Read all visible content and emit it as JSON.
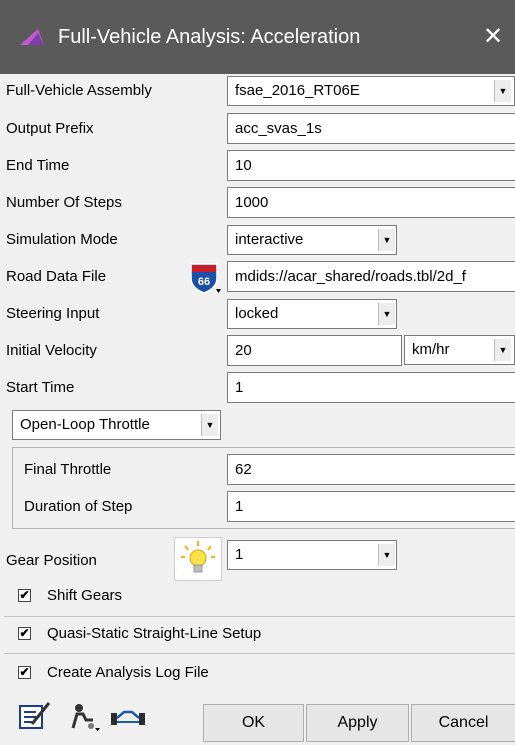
{
  "window": {
    "title": "Full-Vehicle Analysis: Acceleration",
    "close_glyph": "✕"
  },
  "form": {
    "assembly": {
      "label": "Full-Vehicle Assembly",
      "value": "fsae_2016_RT06E"
    },
    "output_prefix": {
      "label": "Output Prefix",
      "value": "acc_svas_1s"
    },
    "end_time": {
      "label": "End Time",
      "value": "10"
    },
    "num_steps": {
      "label": "Number Of Steps",
      "value": "1000"
    },
    "sim_mode": {
      "label": "Simulation Mode",
      "value": "interactive"
    },
    "road_data": {
      "label": "Road Data File",
      "value": "mdids://acar_shared/roads.tbl/2d_f"
    },
    "steering": {
      "label": "Steering Input",
      "value": "locked"
    },
    "velocity": {
      "label": "Initial Velocity",
      "value": "20",
      "unit": "km/hr"
    },
    "start_time": {
      "label": "Start Time",
      "value": "1"
    },
    "throttle_mode": {
      "value": "Open-Loop Throttle"
    },
    "final_throttle": {
      "label": "Final Throttle",
      "value": "62"
    },
    "duration": {
      "label": "Duration of Step",
      "value": "1"
    },
    "gear": {
      "label": "Gear Position",
      "value": "1"
    }
  },
  "checks": {
    "shift_gears": {
      "label": "Shift Gears",
      "checked": true,
      "mark": "✔"
    },
    "quasi_static": {
      "label": "Quasi-Static Straight-Line Setup",
      "checked": true,
      "mark": "✔"
    },
    "log_file": {
      "label": "Create Analysis Log File",
      "checked": true,
      "mark": "✔"
    }
  },
  "buttons": {
    "ok": "OK",
    "apply": "Apply",
    "cancel": "Cancel"
  },
  "icons": {
    "app": "triangle-logo-icon",
    "road": "interstate-66-shield-icon",
    "gear": "lightbulb-icon",
    "tool1": "edit-notes-icon",
    "tool2": "vehicle-settings-icon",
    "tool3": "vehicle-outline-icon"
  },
  "colors": {
    "titlebar": "#5a5a5a",
    "window_bg": "#f0f0f0",
    "field_bg": "#ffffff",
    "accent_purple": "#7e3fa8"
  }
}
